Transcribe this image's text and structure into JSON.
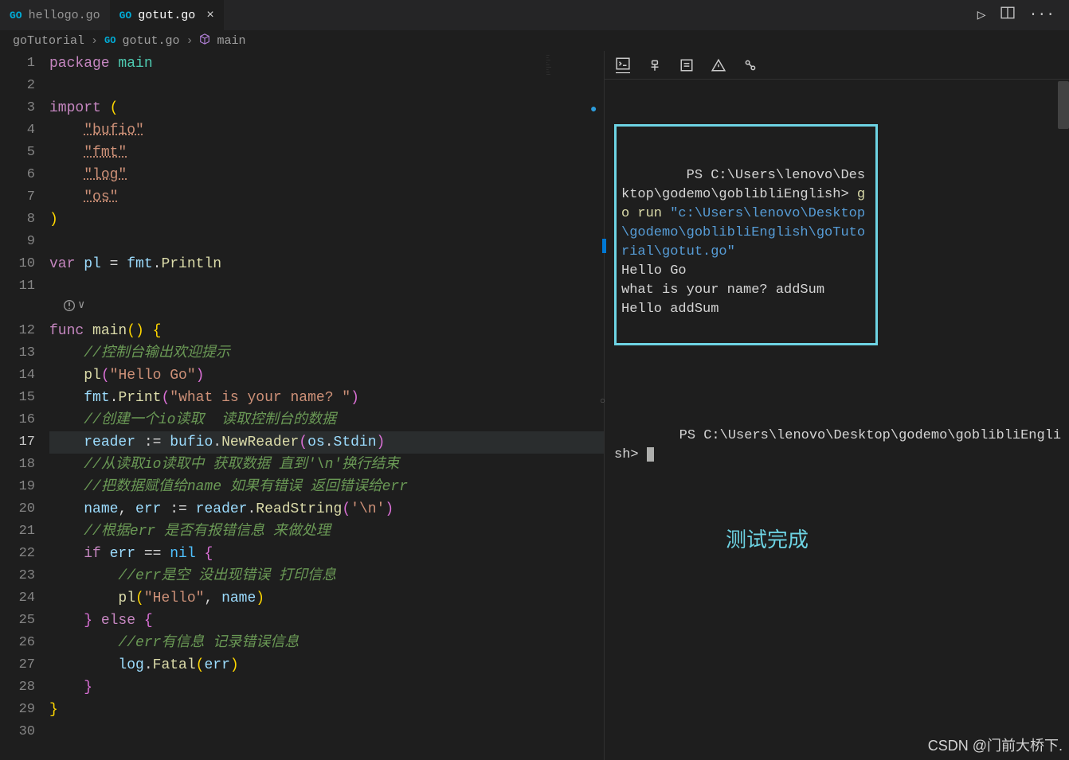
{
  "tabs": [
    {
      "label": "hellogo.go",
      "active": false
    },
    {
      "label": "gotut.go",
      "active": true
    }
  ],
  "breadcrumb": {
    "folder": "goTutorial",
    "file": "gotut.go",
    "symbol": "main"
  },
  "code": {
    "current_line": 17,
    "lines": [
      {
        "n": 1,
        "t": [
          [
            "kw",
            "package "
          ],
          [
            "pkg",
            "main"
          ]
        ]
      },
      {
        "n": 2,
        "t": []
      },
      {
        "n": 3,
        "t": [
          [
            "kw",
            "import "
          ],
          [
            "paren",
            "("
          ]
        ]
      },
      {
        "n": 4,
        "t": [
          [
            "ident",
            "    "
          ],
          [
            "str-u",
            "\"bufio\""
          ]
        ]
      },
      {
        "n": 5,
        "t": [
          [
            "ident",
            "    "
          ],
          [
            "str-u",
            "\"fmt\""
          ]
        ]
      },
      {
        "n": 6,
        "t": [
          [
            "ident",
            "    "
          ],
          [
            "str-u",
            "\"log\""
          ]
        ]
      },
      {
        "n": 7,
        "t": [
          [
            "ident",
            "    "
          ],
          [
            "str-u",
            "\"os\""
          ]
        ]
      },
      {
        "n": 8,
        "t": [
          [
            "paren",
            ")"
          ]
        ]
      },
      {
        "n": 9,
        "t": []
      },
      {
        "n": 10,
        "t": [
          [
            "kw",
            "var "
          ],
          [
            "var",
            "pl"
          ],
          [
            "op",
            " = "
          ],
          [
            "var",
            "fmt"
          ],
          [
            "op",
            "."
          ],
          [
            "fn",
            "Println"
          ]
        ]
      },
      {
        "n": 11,
        "t": []
      },
      {
        "n": 12,
        "t": [
          [
            "kw",
            "func "
          ],
          [
            "fn",
            "main"
          ],
          [
            "paren",
            "()"
          ],
          [
            "ident",
            " "
          ],
          [
            "paren",
            "{"
          ]
        ]
      },
      {
        "n": 13,
        "t": [
          [
            "ident",
            "    "
          ],
          [
            "cmt",
            "//控制台输出欢迎提示"
          ]
        ]
      },
      {
        "n": 14,
        "t": [
          [
            "ident",
            "    "
          ],
          [
            "fn",
            "pl"
          ],
          [
            "paren2",
            "("
          ],
          [
            "str",
            "\"Hello Go\""
          ],
          [
            "paren2",
            ")"
          ]
        ]
      },
      {
        "n": 15,
        "t": [
          [
            "ident",
            "    "
          ],
          [
            "var",
            "fmt"
          ],
          [
            "op",
            "."
          ],
          [
            "fn",
            "Print"
          ],
          [
            "paren2",
            "("
          ],
          [
            "str",
            "\"what is your name? \""
          ],
          [
            "paren2",
            ")"
          ]
        ]
      },
      {
        "n": 16,
        "t": [
          [
            "ident",
            "    "
          ],
          [
            "cmt",
            "//创建一个io读取  读取控制台的数据"
          ]
        ]
      },
      {
        "n": 17,
        "t": [
          [
            "ident",
            "    "
          ],
          [
            "var",
            "reader"
          ],
          [
            "op",
            " := "
          ],
          [
            "var",
            "bufio"
          ],
          [
            "op",
            "."
          ],
          [
            "fn",
            "NewReader"
          ],
          [
            "paren2",
            "("
          ],
          [
            "var",
            "os"
          ],
          [
            "op",
            "."
          ],
          [
            "var",
            "Stdin"
          ],
          [
            "paren2",
            ")"
          ]
        ]
      },
      {
        "n": 18,
        "t": [
          [
            "ident",
            "    "
          ],
          [
            "cmt",
            "//从读取io读取中 获取数据 直到'\\n'换行结束"
          ]
        ]
      },
      {
        "n": 19,
        "t": [
          [
            "ident",
            "    "
          ],
          [
            "cmt",
            "//把数据赋值给name 如果有错误 返回错误给err"
          ]
        ]
      },
      {
        "n": 20,
        "t": [
          [
            "ident",
            "    "
          ],
          [
            "var",
            "name"
          ],
          [
            "op",
            ", "
          ],
          [
            "var",
            "err"
          ],
          [
            "op",
            " := "
          ],
          [
            "var",
            "reader"
          ],
          [
            "op",
            "."
          ],
          [
            "fn",
            "ReadString"
          ],
          [
            "paren2",
            "("
          ],
          [
            "str",
            "'\\n'"
          ],
          [
            "paren2",
            ")"
          ]
        ]
      },
      {
        "n": 21,
        "t": [
          [
            "ident",
            "    "
          ],
          [
            "cmt",
            "//根据err 是否有报错信息 来做处理"
          ]
        ]
      },
      {
        "n": 22,
        "t": [
          [
            "ident",
            "    "
          ],
          [
            "kw",
            "if "
          ],
          [
            "var",
            "err"
          ],
          [
            "op",
            " == "
          ],
          [
            "const",
            "nil"
          ],
          [
            "ident",
            " "
          ],
          [
            "paren2",
            "{"
          ]
        ]
      },
      {
        "n": 23,
        "t": [
          [
            "ident",
            "        "
          ],
          [
            "cmt",
            "//err是空 没出现错误 打印信息"
          ]
        ]
      },
      {
        "n": 24,
        "t": [
          [
            "ident",
            "        "
          ],
          [
            "fn",
            "pl"
          ],
          [
            "paren",
            "("
          ],
          [
            "str",
            "\"Hello\""
          ],
          [
            "op",
            ", "
          ],
          [
            "var",
            "name"
          ],
          [
            "paren",
            ")"
          ]
        ]
      },
      {
        "n": 25,
        "t": [
          [
            "ident",
            "    "
          ],
          [
            "paren2",
            "}"
          ],
          [
            "kw",
            " else "
          ],
          [
            "paren2",
            "{"
          ]
        ]
      },
      {
        "n": 26,
        "t": [
          [
            "ident",
            "        "
          ],
          [
            "cmt",
            "//err有信息 记录错误信息"
          ]
        ]
      },
      {
        "n": 27,
        "t": [
          [
            "ident",
            "        "
          ],
          [
            "var",
            "log"
          ],
          [
            "op",
            "."
          ],
          [
            "fn",
            "Fatal"
          ],
          [
            "paren",
            "("
          ],
          [
            "var",
            "err"
          ],
          [
            "paren",
            ")"
          ]
        ]
      },
      {
        "n": 28,
        "t": [
          [
            "ident",
            "    "
          ],
          [
            "paren2",
            "}"
          ]
        ]
      },
      {
        "n": 29,
        "t": [
          [
            "paren",
            "}"
          ]
        ]
      },
      {
        "n": 30,
        "t": []
      }
    ]
  },
  "terminal": {
    "prompt1": "PS C:\\Users\\lenovo\\Desktop\\godemo\\goblibliEnglish> ",
    "cmd": "go run",
    "cmd_arg": " \"c:\\Users\\lenovo\\Desktop\\godemo\\goblibliEnglish\\goTutorial\\gotut.go\"",
    "out1": "Hello Go",
    "out2": "what is your name? addSum",
    "out3": "Hello addSum",
    "prompt2": "PS C:\\Users\\lenovo\\Desktop\\godemo\\goblibliEnglish> ",
    "annotation": "测试完成"
  },
  "watermark": "CSDN @门前大桥下."
}
